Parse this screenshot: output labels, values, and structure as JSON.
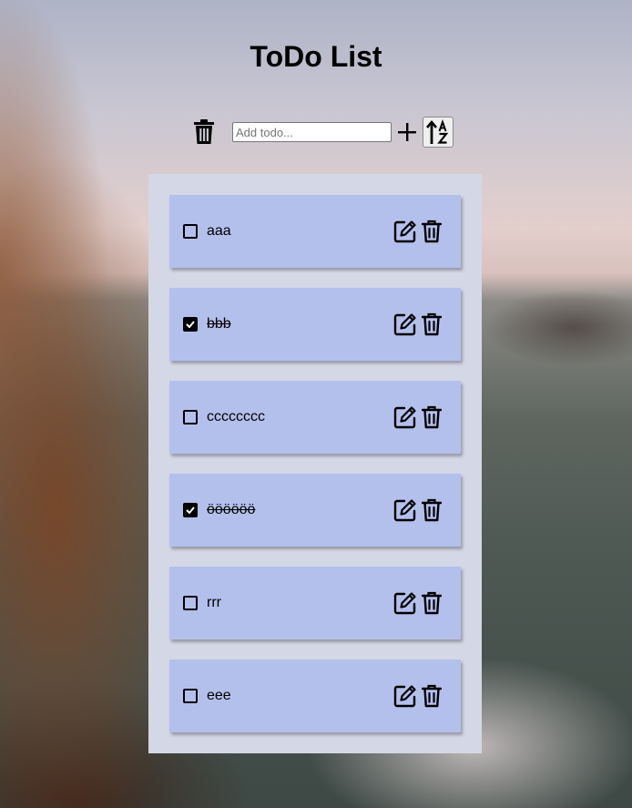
{
  "app": {
    "title": "ToDo List"
  },
  "toolbar": {
    "delete_all_icon": "trash-icon",
    "input_placeholder": "Add todo...",
    "input_value": "",
    "add_icon": "plus-icon",
    "sort_icon": "sort-alpha-up-icon"
  },
  "todos": [
    {
      "text": "aaa",
      "done": false
    },
    {
      "text": "bbb",
      "done": true
    },
    {
      "text": "cccccccc",
      "done": false
    },
    {
      "text": "öööööö",
      "done": true
    },
    {
      "text": "rrr",
      "done": false
    },
    {
      "text": "eee",
      "done": false
    }
  ],
  "colors": {
    "panel": "#d4d7e6",
    "item": "#b4c0ec"
  }
}
